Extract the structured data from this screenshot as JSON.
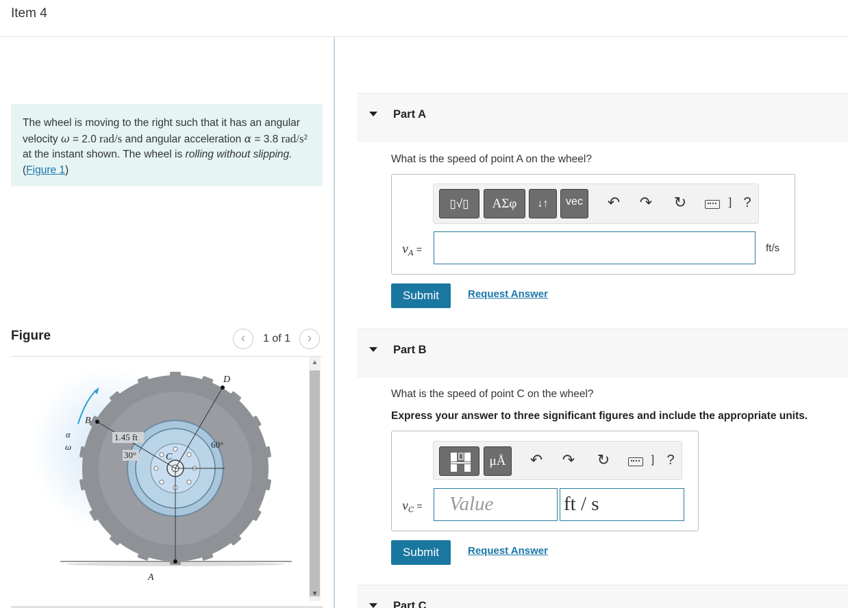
{
  "header": {
    "title": "Item 4"
  },
  "problem": {
    "text_1": "The wheel is moving to the right such that it has an angular velocity ",
    "omega_symbol": "ω",
    "text_2": " = 2.0 ",
    "unit_rad_s": "rad/s",
    "text_3": " and angular acceleration ",
    "alpha_symbol": "α",
    "text_4": " = 3.8 ",
    "unit_rad_s2": "rad/s²",
    "text_5": " at the instant shown. The wheel is ",
    "italic_text": "rolling without slipping.",
    "link_open": " (",
    "figure_link": "Figure 1",
    "link_close": ")"
  },
  "figure": {
    "label": "Figure",
    "counter": "1 of 1",
    "prev_icon": "chevron-left-icon",
    "next_icon": "chevron-right-icon",
    "labels": {
      "D": "D",
      "B": "B",
      "C": "C",
      "A": "A",
      "radius": "1.45 ft",
      "angle_30": "30°",
      "angle_60": "60°",
      "alpha": "α",
      "omega": "ω"
    }
  },
  "part_a": {
    "title": "Part A",
    "question": "What is the speed of point A on the wheel?",
    "toolbar": {
      "btn_templates": "▯√▯",
      "btn_greek": "ΑΣφ",
      "btn_arrows": "↓↑",
      "btn_vec": "vec",
      "help": "?"
    },
    "var_name": "v",
    "var_sub": "A",
    "equals": " =",
    "value": "",
    "unit": "ft/s",
    "submit": "Submit",
    "request": "Request Answer"
  },
  "part_b": {
    "title": "Part B",
    "question": "What is the speed of point C on the wheel?",
    "instructions": "Express your answer to three significant figures and include the appropriate units.",
    "toolbar": {
      "btn_units": "μÅ",
      "help": "?"
    },
    "var_name": "v",
    "var_sub": "C",
    "equals": " =",
    "value_placeholder": "Value",
    "unit_value": "ft / s",
    "submit": "Submit",
    "request": "Request Answer"
  },
  "part_c": {
    "title": "Part C"
  },
  "colors": {
    "accent": "#1a77a0",
    "problem_bg": "#e6f4f4",
    "toolbar_btn": "#6d6d6d"
  }
}
